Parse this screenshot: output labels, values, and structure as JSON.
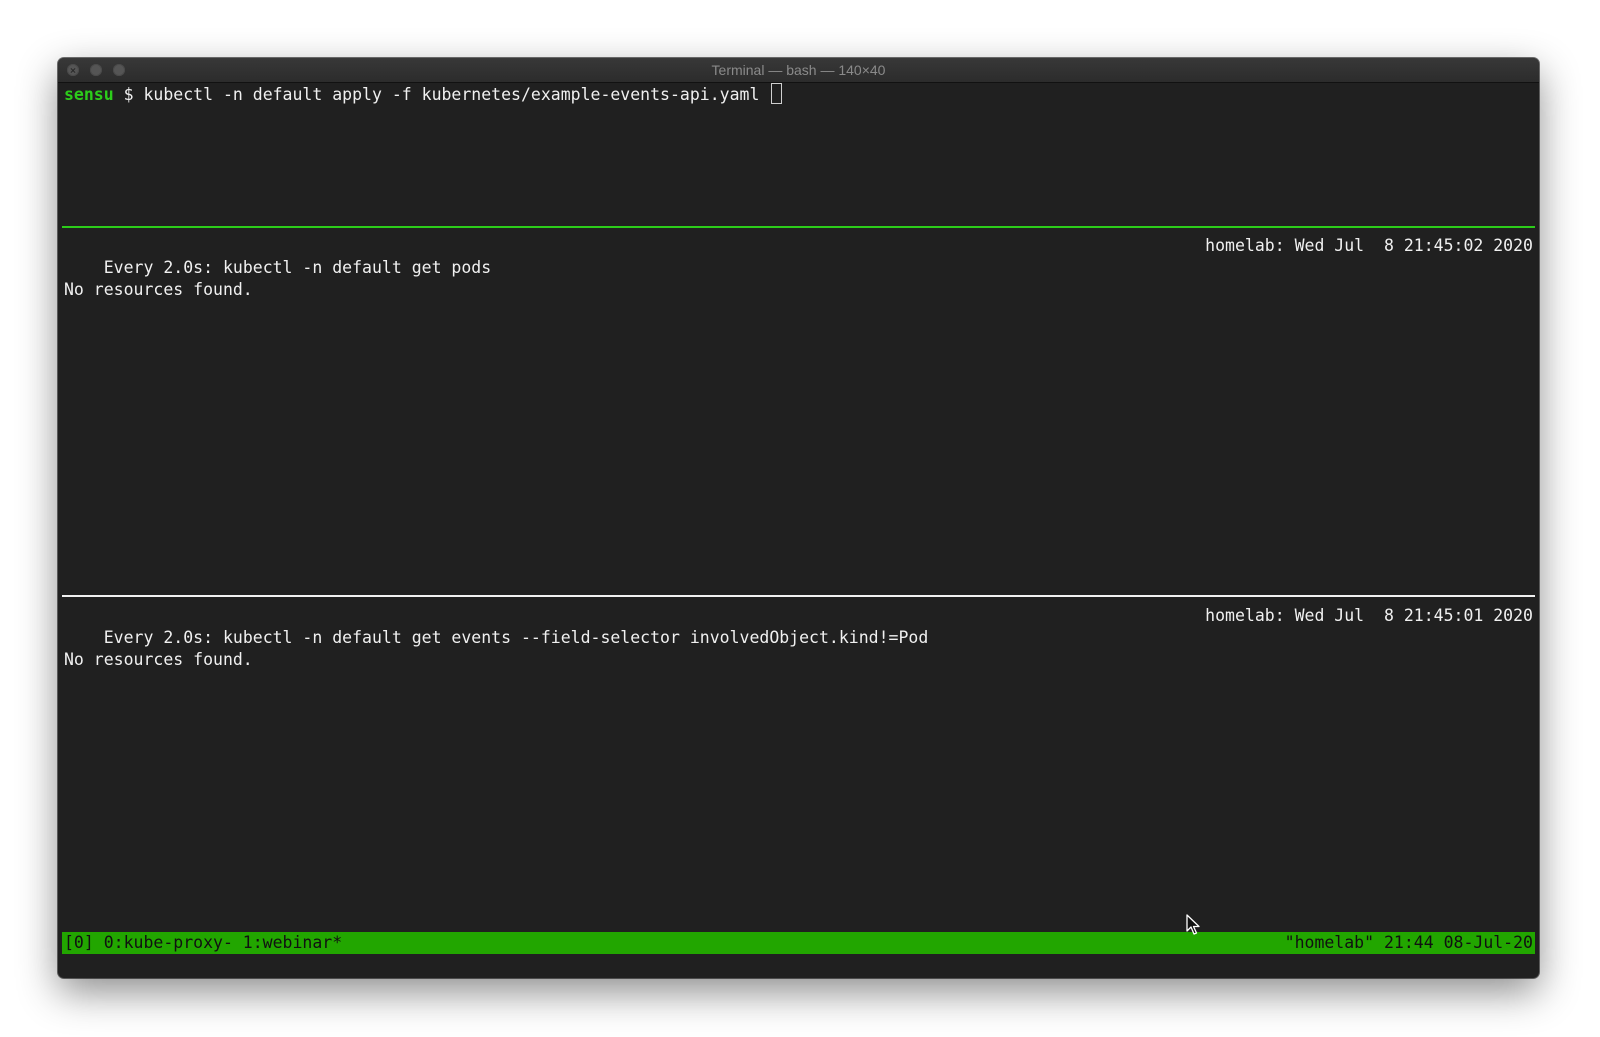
{
  "window": {
    "title": "Terminal — bash — 140×40"
  },
  "shell": {
    "prompt_user": "sensu",
    "prompt_symbol": " $ ",
    "command": "kubectl -n default apply -f kubernetes/example-events-api.yaml "
  },
  "pane_pods": {
    "header_left": "Every 2.0s: kubectl -n default get pods",
    "header_right": "homelab: Wed Jul  8 21:45:02 2020",
    "output": "No resources found."
  },
  "pane_events": {
    "header_left": "Every 2.0s: kubectl -n default get events --field-selector involvedObject.kind!=Pod",
    "header_right": "homelab: Wed Jul  8 21:45:01 2020",
    "output": "No resources found."
  },
  "tmux": {
    "left": "[0] 0:kube-proxy- 1:webinar*",
    "right": "\"homelab\" 21:44 08-Jul-20",
    "bar_color": "#22a600"
  },
  "colors": {
    "background": "#202020",
    "prompt": "#2ccc1a",
    "active_pane_border": "#2ccc1a",
    "pane_border": "#f0f0f0"
  },
  "icons": {
    "close": "close-icon",
    "minimize": "minimize-icon",
    "maximize": "maximize-icon",
    "pointer": "mouse-pointer-icon"
  }
}
